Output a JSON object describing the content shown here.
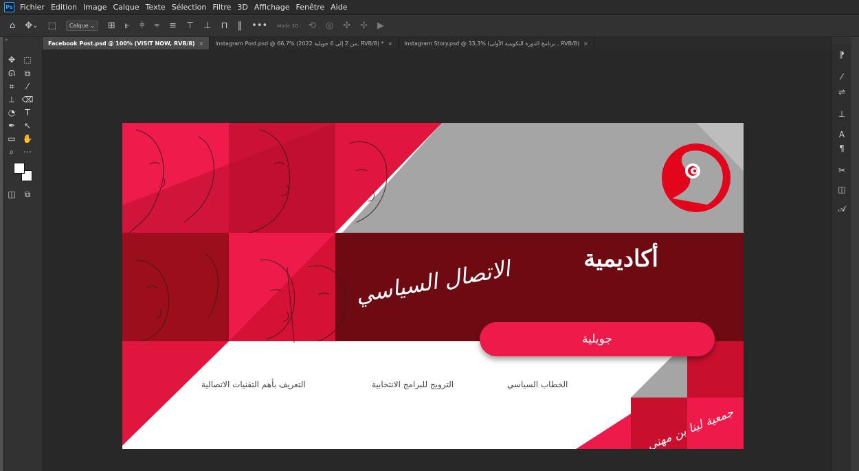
{
  "app": {
    "logo_text": "Ps"
  },
  "menu": [
    "Fichier",
    "Edition",
    "Image",
    "Calque",
    "Texte",
    "Sélection",
    "Filtre",
    "3D",
    "Affichage",
    "Fenêtre",
    "Aide"
  ],
  "options": {
    "layer_select": "Calque",
    "more": "•••",
    "mode3d": "Mode 3D :"
  },
  "tabs": [
    {
      "label": "Facebook Post.psd @ 100% (VISIT NOW, RVB/8)",
      "close": "×"
    },
    {
      "label": "Instagram Post.psd @ 66,7% (2022 من 2 إلى 6 جويلية, RVB/8) *",
      "close": "×"
    },
    {
      "label": "Instagram Story.psd @ 33,3% (برنامج الدورة التكوينية الأولى , RVB/8)",
      "close": "×"
    }
  ],
  "artwork": {
    "headline": "أكاديمية",
    "subtitle": "الاتصال السياسي",
    "month_pill": "جويلية",
    "topics": [
      "الخطاب السياسي",
      "الترويج للبرامج الانتخابية",
      "التعريف بأهم التقنيات الاتصالية"
    ],
    "association": "جمعية لينا بن مهني",
    "colors": {
      "crimson": "#ee1a4a",
      "dark_red": "#6d0a12",
      "red": "#c8102e",
      "grey": "#a5a5a5"
    }
  },
  "colors": {
    "menubar": "#2b2b2b",
    "panel": "#323232",
    "canvas_bg": "#282828",
    "accent": "#31a8ff"
  }
}
